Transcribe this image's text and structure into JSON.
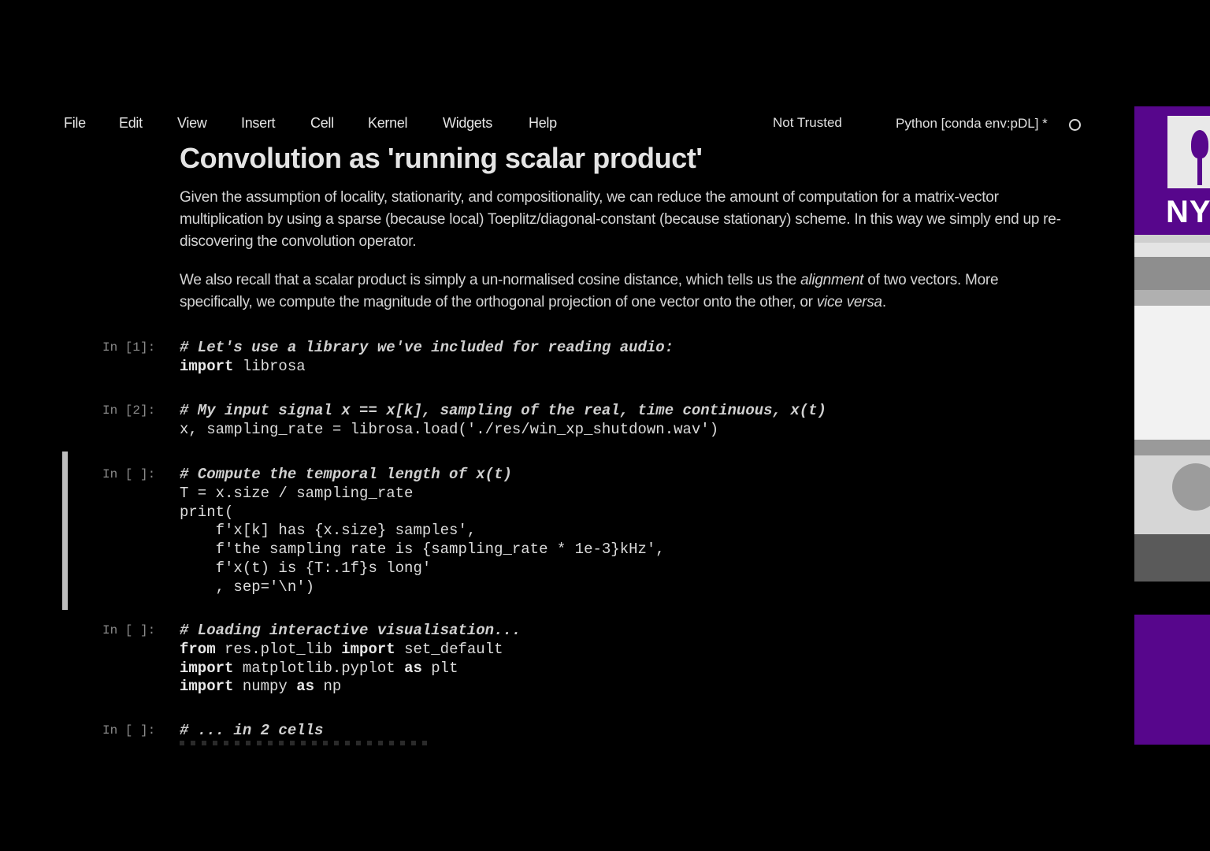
{
  "menu": {
    "file": "File",
    "edit": "Edit",
    "view": "View",
    "insert": "Insert",
    "cell": "Cell",
    "kernel": "Kernel",
    "widgets": "Widgets",
    "help": "Help"
  },
  "status": {
    "trusted": "Not Trusted",
    "kernel_name": "Python [conda env:pDL] *"
  },
  "markdown": {
    "title": "Convolution as 'running scalar product'",
    "para1": "Given the assumption of locality, stationarity, and compositionality, we can reduce the amount of computation for a matrix-vector multiplication by using a sparse (because local) Toeplitz/diagonal-constant (because stationary) scheme. In this way we simply end up re-discovering the convolution operator.",
    "para2_a": "We also recall that a scalar product is simply a un-normalised cosine distance, which tells us the ",
    "para2_em1": "alignment",
    "para2_b": " of two vectors. More specifically, we compute the magnitude of the orthogonal projection of one vector onto the other, or ",
    "para2_em2": "vice versa",
    "para2_c": "."
  },
  "cells": [
    {
      "prompt": "In [1]:",
      "lines": [
        {
          "cm": "# Let's use a library we've included for reading audio:"
        },
        {
          "kw": "import",
          "rest": " librosa"
        }
      ]
    },
    {
      "prompt": "In [2]:",
      "lines": [
        {
          "cm": "# My input signal x == x[k], sampling of the real, time continuous, x(t)"
        },
        {
          "text": "x, sampling_rate = librosa.load('./res/win_xp_shutdown.wav')"
        }
      ]
    },
    {
      "prompt": "In [ ]:",
      "lines": [
        {
          "cm": "# Compute the temporal length of x(t)"
        },
        {
          "text": "T = x.size / sampling_rate"
        },
        {
          "text": "print("
        },
        {
          "text": "    f'x[k] has {x.size} samples',"
        },
        {
          "text": "    f'the sampling rate is {sampling_rate * 1e-3}kHz',"
        },
        {
          "text": "    f'x(t) is {T:.1f}s long'"
        },
        {
          "text": "    , sep='\\n')"
        }
      ]
    },
    {
      "prompt": "In [ ]:",
      "lines": [
        {
          "cm": "# Loading interactive visualisation..."
        },
        {
          "kw": "from",
          "rest": " res.plot_lib ",
          "kw2": "import",
          "rest2": " set_default"
        },
        {
          "kw": "import",
          "rest": " matplotlib.pyplot ",
          "kw2": "as",
          "rest2": " plt"
        },
        {
          "kw": "import",
          "rest": " numpy ",
          "kw2": "as",
          "rest2": " np"
        }
      ]
    },
    {
      "prompt": "In [ ]:",
      "lines": [
        {
          "cm": "# ... in 2 cells"
        }
      ]
    }
  ],
  "side": {
    "logo_text": "NYU"
  }
}
